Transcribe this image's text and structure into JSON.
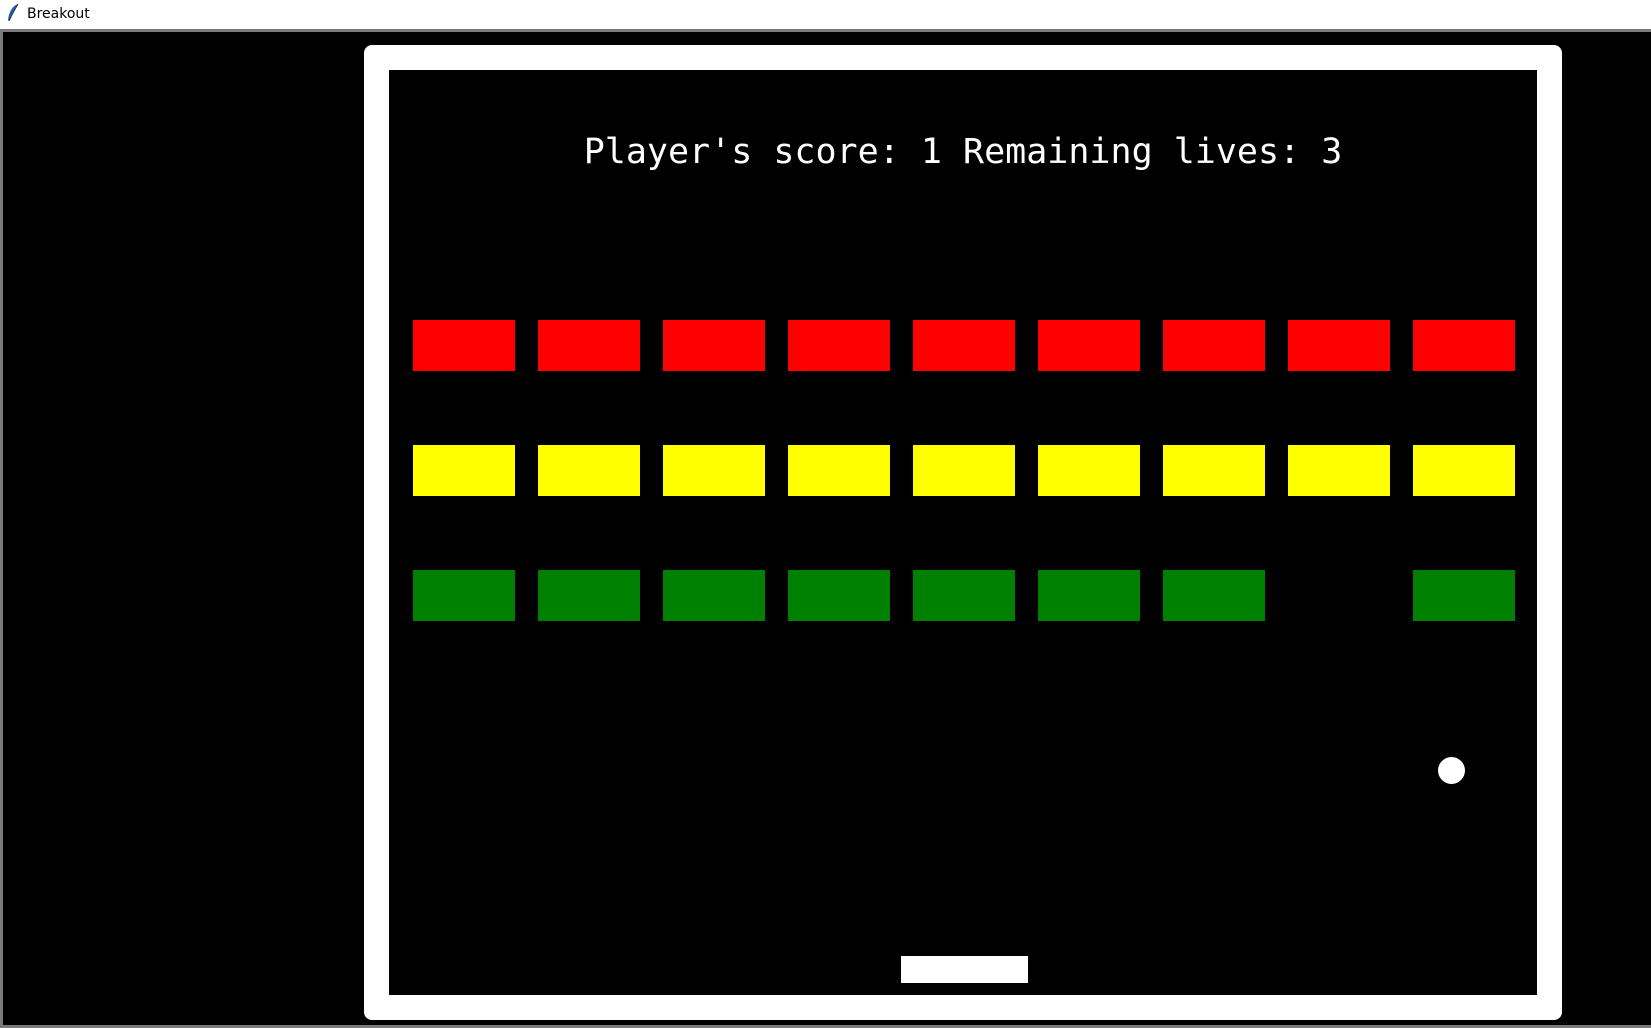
{
  "window": {
    "title": "Breakout",
    "icon": "feather-icon"
  },
  "hud": {
    "score_label": "Player's score:",
    "score": 1,
    "lives_label": "Remaining lives:",
    "lives": 3
  },
  "colors": {
    "background": "#000000",
    "wall": "#ffffff",
    "ball": "#ffffff",
    "paddle": "#ffffff"
  },
  "bricks": {
    "columns": 9,
    "rows": [
      {
        "name": "red",
        "color": "#ff0000",
        "present": [
          true,
          true,
          true,
          true,
          true,
          true,
          true,
          true,
          true
        ]
      },
      {
        "name": "yellow",
        "color": "#ffff00",
        "present": [
          true,
          true,
          true,
          true,
          true,
          true,
          true,
          true,
          true
        ]
      },
      {
        "name": "green",
        "color": "#008000",
        "present": [
          true,
          true,
          true,
          true,
          true,
          true,
          true,
          false,
          true
        ]
      }
    ]
  }
}
